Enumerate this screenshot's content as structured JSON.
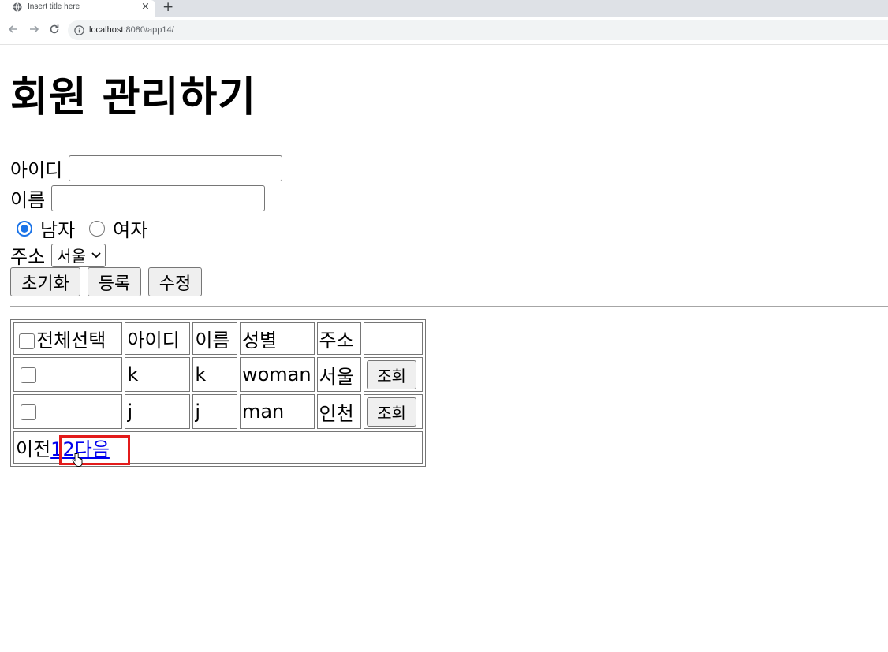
{
  "browser": {
    "tab_title": "Insert title here",
    "tab_close": "×",
    "new_tab": "+",
    "url_host": "localhost",
    "url_rest": ":8080/app14/"
  },
  "page": {
    "title": "회원 관리하기",
    "form": {
      "id_label": "아이디",
      "id_value": "",
      "name_label": "이름",
      "name_value": "",
      "gender_male": "남자",
      "gender_female": "여자",
      "gender_selected": "남자",
      "address_label": "주소",
      "address_selected": "서울"
    },
    "buttons": {
      "reset": "초기화",
      "register": "등록",
      "update": "수정"
    },
    "table": {
      "headers": [
        "전체선택",
        "아이디",
        "이름",
        "성별",
        "주소",
        ""
      ],
      "rows": [
        {
          "id": "k",
          "name": "k",
          "gender": "woman",
          "address": "서울",
          "action": "조회"
        },
        {
          "id": "j",
          "name": "j",
          "gender": "man",
          "address": "인천",
          "action": "조회"
        }
      ],
      "pager": {
        "prev": "이전",
        "pages": [
          "1",
          "2"
        ],
        "next": "다음"
      }
    }
  },
  "colors": {
    "accent": "#1a73e8",
    "link": "#0000ee",
    "highlight": "#e31b1b"
  }
}
